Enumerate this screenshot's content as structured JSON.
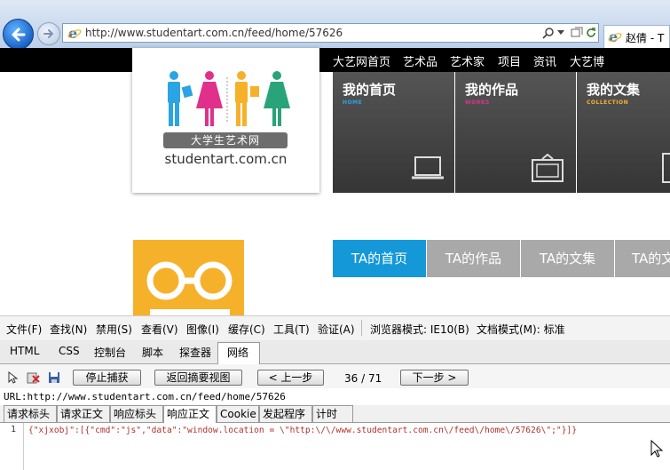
{
  "browser": {
    "url": "http://www.studentart.com.cn/feed/home/57626",
    "tab_title": "赵倩 - T"
  },
  "site": {
    "nav": [
      "大艺网首页",
      "艺术品",
      "艺术家",
      "项目",
      "资讯",
      "大艺博"
    ],
    "logo": {
      "banner": "大学生艺术网",
      "domain": "studentart.com.cn"
    },
    "tiles": [
      {
        "title": "我的首页",
        "subtitle": "HOME",
        "subtitle_color": "#2aa4e3"
      },
      {
        "title": "我的作品",
        "subtitle": "WORKS",
        "subtitle_color": "#e0308b"
      },
      {
        "title": "我的文集",
        "subtitle": "COLLECTION",
        "subtitle_color": "#f6b12b"
      }
    ],
    "tabs": [
      {
        "label": "TA的首页",
        "active": true
      },
      {
        "label": "TA的作品",
        "active": false
      },
      {
        "label": "TA的文集",
        "active": false
      },
      {
        "label": "TA的文",
        "active": false
      }
    ],
    "colors": {
      "active_tab": "#1598d8",
      "inactive_tab": "#a9a9a9"
    }
  },
  "devtools": {
    "menu": [
      "文件(F)",
      "查找(N)",
      "禁用(S)",
      "查看(V)",
      "图像(I)",
      "缓存(C)",
      "工具(T)",
      "验证(A)",
      "浏览器模式: IE10(B)",
      "文档模式(M): 标准"
    ],
    "tabs": [
      "HTML",
      "CSS",
      "控制台",
      "脚本",
      "探查器",
      "网络"
    ],
    "active_tab": "网络",
    "toolbar": {
      "stop_capture": "停止捕获",
      "back_to_summary": "返回摘要视图",
      "prev": "< 上一步",
      "counter": "36 / 71",
      "next": "下一步 >"
    },
    "url_line": "URL:http://www.studentart.com.cn/feed/home/57626",
    "subtabs": [
      "请求标头",
      "请求正文",
      "响应标头",
      "响应正文",
      "Cookie",
      "发起程序",
      "计时"
    ],
    "active_subtab": "响应正文",
    "line_number": "1",
    "code": "{\"xjxobj\":[{\"cmd\":\"js\",\"data\":\"window.location = \\\"http:\\/\\/www.studentart.com.cn\\/feed\\/home\\/57626\\\";\"}]}"
  }
}
